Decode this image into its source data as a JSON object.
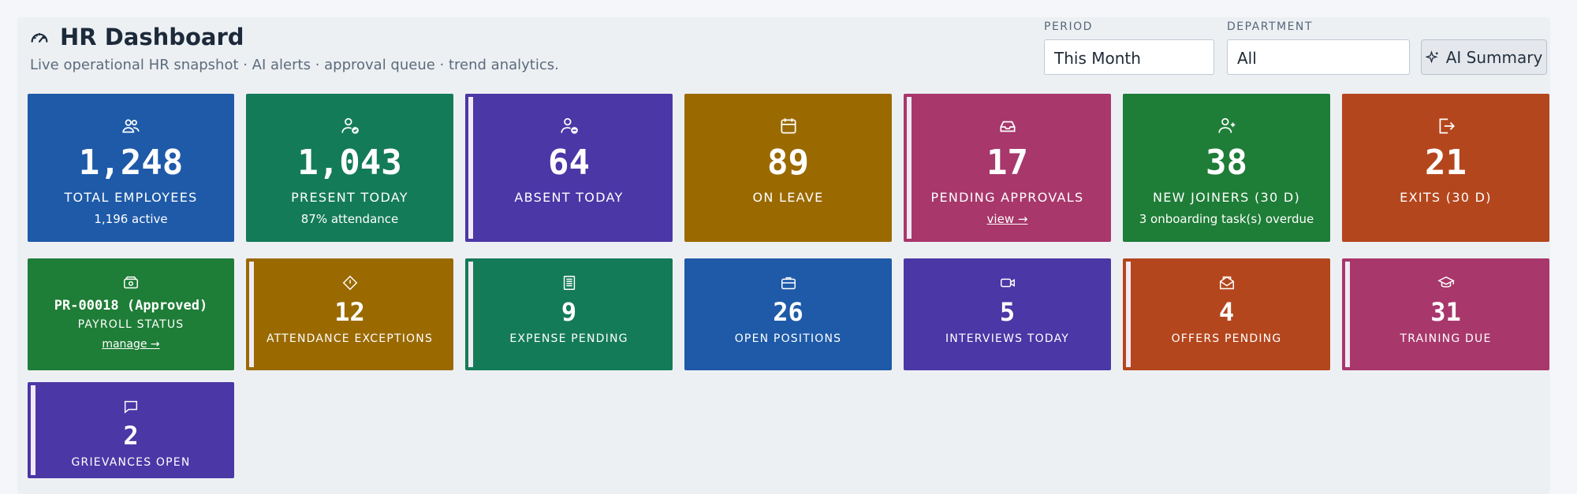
{
  "header": {
    "title": "HR Dashboard",
    "subtitle": "Live operational HR snapshot · AI alerts · approval queue · trend analytics.",
    "icon": "gauge-icon"
  },
  "filters": {
    "period_label": "PERIOD",
    "period_value": "This Month",
    "department_label": "DEPARTMENT",
    "department_value": "All",
    "ai_button": "AI Summary"
  },
  "colors": {
    "blue": "#1e5aa8",
    "teal": "#147b58",
    "purple": "#4b37a6",
    "gold": "#9a6a00",
    "pink": "#a8376b",
    "green": "#1e7d37",
    "orange": "#b4461d"
  },
  "row1": [
    {
      "icon": "users-icon",
      "value": "1,248",
      "label": "TOTAL EMPLOYEES",
      "sub": "1,196 active"
    },
    {
      "icon": "user-check-icon",
      "value": "1,043",
      "label": "PRESENT TODAY",
      "sub": "87% attendance"
    },
    {
      "icon": "user-minus-icon",
      "value": "64",
      "label": "ABSENT TODAY",
      "sub": ""
    },
    {
      "icon": "calendar-icon",
      "value": "89",
      "label": "ON LEAVE",
      "sub": ""
    },
    {
      "icon": "inbox-icon",
      "value": "17",
      "label": "PENDING APPROVALS",
      "link": "view →"
    },
    {
      "icon": "user-plus-icon",
      "value": "38",
      "label": "NEW JOINERS (30 D)",
      "sub": "3 onboarding task(s) overdue"
    },
    {
      "icon": "logout-icon",
      "value": "21",
      "label": "EXITS (30 D)",
      "sub": ""
    }
  ],
  "row2": [
    {
      "icon": "cash-icon",
      "value": "PR-00018 (Approved)",
      "label": "PAYROLL STATUS",
      "link": "manage →"
    },
    {
      "icon": "alert-diamond-icon",
      "value": "12",
      "label": "ATTENDANCE EXCEPTIONS"
    },
    {
      "icon": "receipt-icon",
      "value": "9",
      "label": "EXPENSE PENDING"
    },
    {
      "icon": "briefcase-icon",
      "value": "26",
      "label": "OPEN POSITIONS"
    },
    {
      "icon": "video-icon",
      "value": "5",
      "label": "INTERVIEWS TODAY"
    },
    {
      "icon": "mail-open-icon",
      "value": "4",
      "label": "OFFERS PENDING"
    },
    {
      "icon": "graduation-cap-icon",
      "value": "31",
      "label": "TRAINING DUE"
    }
  ],
  "row3": [
    {
      "icon": "chat-icon",
      "value": "2",
      "label": "GRIEVANCES OPEN"
    }
  ]
}
